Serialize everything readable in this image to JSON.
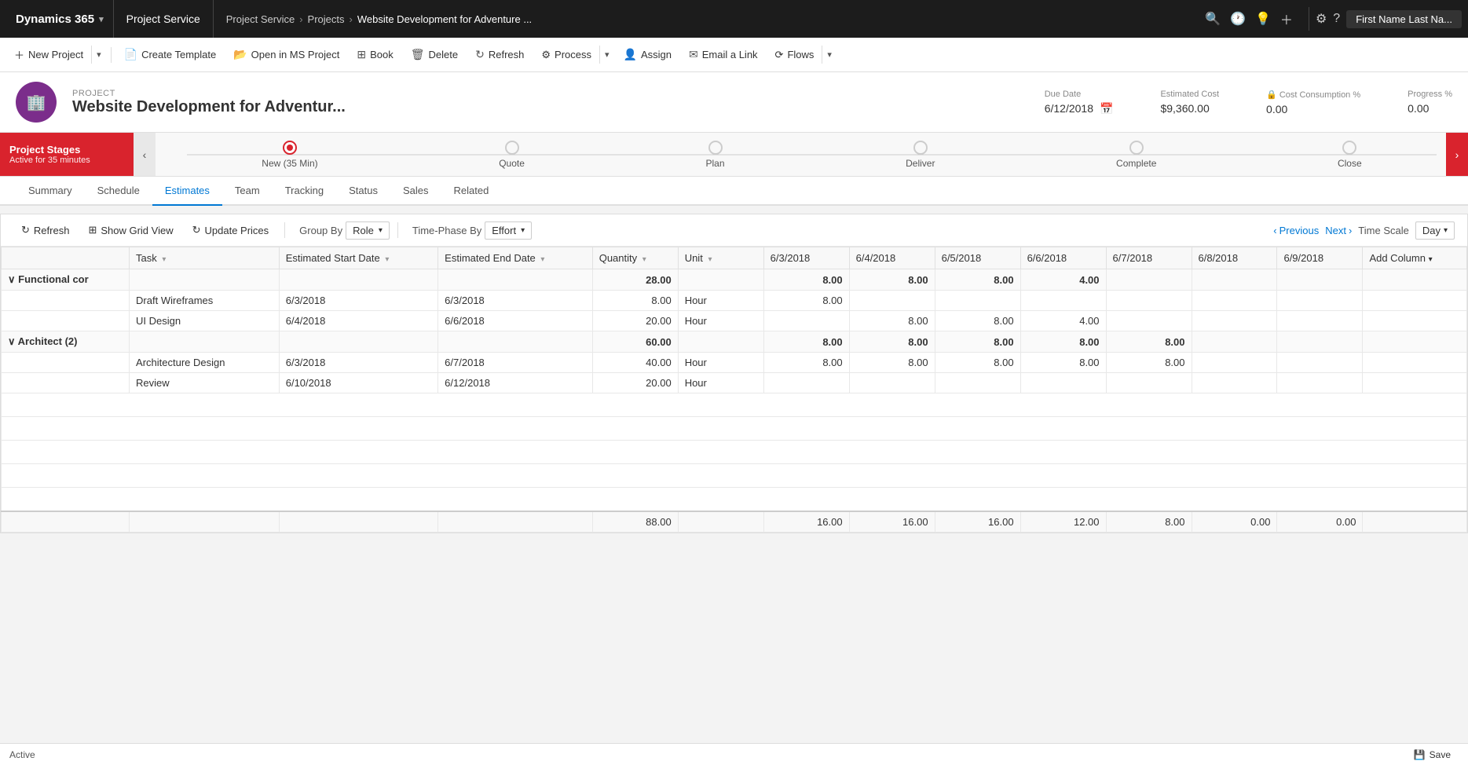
{
  "topNav": {
    "brand": "Dynamics 365",
    "brandChevron": "▾",
    "module": "Project Service",
    "breadcrumbs": [
      "Project Service",
      "Projects",
      "Website Development for Adventure ..."
    ],
    "breadcrumbSep": "›",
    "icons": [
      "🔍",
      "🕐",
      "💡",
      "＋"
    ],
    "settings": "⚙",
    "help": "?",
    "user": "First Name Last Na..."
  },
  "commandBar": {
    "buttons": [
      {
        "id": "new-project",
        "label": "New Project",
        "icon": "＋",
        "hasSplit": true
      },
      {
        "id": "create-template",
        "label": "Create Template",
        "icon": "📄",
        "hasSplit": false
      },
      {
        "id": "open-ms-project",
        "label": "Open in MS Project",
        "icon": "📂",
        "hasSplit": false
      },
      {
        "id": "book",
        "label": "Book",
        "icon": "⊞",
        "hasSplit": false
      },
      {
        "id": "delete",
        "label": "Delete",
        "icon": "🗑",
        "hasSplit": false
      },
      {
        "id": "refresh",
        "label": "Refresh",
        "icon": "↻",
        "hasSplit": false
      },
      {
        "id": "process",
        "label": "Process",
        "icon": "⚙",
        "hasSplit": true
      },
      {
        "id": "assign",
        "label": "Assign",
        "icon": "👤",
        "hasSplit": false
      },
      {
        "id": "email-link",
        "label": "Email a Link",
        "icon": "✉",
        "hasSplit": false
      },
      {
        "id": "flows",
        "label": "Flows",
        "icon": "⟳",
        "hasSplit": true
      }
    ]
  },
  "project": {
    "label": "PROJECT",
    "name": "Website Development for Adventur...",
    "avatarIcon": "🏢",
    "dueDateLabel": "Due Date",
    "dueDate": "6/12/2018",
    "calendarIcon": "📅",
    "estimatedCostLabel": "Estimated Cost",
    "estimatedCost": "$9,360.00",
    "costConsumptionLabel": "Cost Consumption %",
    "costConsumptionLockIcon": "🔒",
    "costConsumption": "0.00",
    "progressLabel": "Progress %",
    "progress": "0.00"
  },
  "stages": {
    "labelTitle": "Project Stages",
    "labelSub": "Active for 35 minutes",
    "items": [
      {
        "id": "new",
        "label": "New (35 Min)",
        "active": true
      },
      {
        "id": "quote",
        "label": "Quote",
        "active": false
      },
      {
        "id": "plan",
        "label": "Plan",
        "active": false
      },
      {
        "id": "deliver",
        "label": "Deliver",
        "active": false
      },
      {
        "id": "complete",
        "label": "Complete",
        "active": false
      },
      {
        "id": "close",
        "label": "Close",
        "active": false
      }
    ]
  },
  "tabs": {
    "items": [
      {
        "id": "summary",
        "label": "Summary",
        "active": false
      },
      {
        "id": "schedule",
        "label": "Schedule",
        "active": false
      },
      {
        "id": "estimates",
        "label": "Estimates",
        "active": true
      },
      {
        "id": "team",
        "label": "Team",
        "active": false
      },
      {
        "id": "tracking",
        "label": "Tracking",
        "active": false
      },
      {
        "id": "status",
        "label": "Status",
        "active": false
      },
      {
        "id": "sales",
        "label": "Sales",
        "active": false
      },
      {
        "id": "related",
        "label": "Related",
        "active": false
      }
    ]
  },
  "estimatesToolbar": {
    "refreshLabel": "Refresh",
    "showGridLabel": "Show Grid View",
    "updatePricesLabel": "Update Prices",
    "groupByLabel": "Group By",
    "groupByValue": "Role",
    "timePhaseByLabel": "Time-Phase By",
    "timePhaseByValue": "Effort",
    "previousLabel": "Previous",
    "nextLabel": "Next",
    "timeScaleLabel": "Time Scale",
    "timeScaleValue": "Day"
  },
  "grid": {
    "columns": [
      {
        "id": "col-blank",
        "label": "",
        "sortable": false
      },
      {
        "id": "col-task",
        "label": "Task",
        "sortable": true
      },
      {
        "id": "col-start",
        "label": "Estimated Start Date",
        "sortable": true
      },
      {
        "id": "col-end",
        "label": "Estimated End Date",
        "sortable": true
      },
      {
        "id": "col-qty",
        "label": "Quantity",
        "sortable": true
      },
      {
        "id": "col-unit",
        "label": "Unit",
        "sortable": true
      },
      {
        "id": "col-6-3",
        "label": "6/3/2018",
        "sortable": false
      },
      {
        "id": "col-6-4",
        "label": "6/4/2018",
        "sortable": false
      },
      {
        "id": "col-6-5",
        "label": "6/5/2018",
        "sortable": false
      },
      {
        "id": "col-6-6",
        "label": "6/6/2018",
        "sortable": false
      },
      {
        "id": "col-6-7",
        "label": "6/7/2018",
        "sortable": false
      },
      {
        "id": "col-6-8",
        "label": "6/8/2018",
        "sortable": false
      },
      {
        "id": "col-6-9",
        "label": "6/9/2018",
        "sortable": false
      },
      {
        "id": "col-add",
        "label": "Add Column",
        "sortable": false,
        "isAdd": true
      }
    ],
    "groups": [
      {
        "id": "functional-con",
        "label": "Functional con",
        "qty": "28.00",
        "unit": "",
        "d63": "8.00",
        "d64": "8.00",
        "d65": "8.00",
        "d66": "4.00",
        "d67": "",
        "d68": "",
        "d69": "",
        "rows": [
          {
            "task": "Draft Wireframes",
            "start": "6/3/2018",
            "end": "6/3/2018",
            "qty": "8.00",
            "unit": "Hour",
            "d63": "8.00",
            "d64": "",
            "d65": "",
            "d66": "",
            "d67": "",
            "d68": "",
            "d69": ""
          },
          {
            "task": "UI Design",
            "start": "6/4/2018",
            "end": "6/6/2018",
            "qty": "20.00",
            "unit": "Hour",
            "d63": "",
            "d64": "8.00",
            "d65": "8.00",
            "d66": "4.00",
            "d67": "",
            "d68": "",
            "d69": ""
          }
        ]
      },
      {
        "id": "architect-2",
        "label": "Architect (2)",
        "qty": "60.00",
        "unit": "",
        "d63": "8.00",
        "d64": "8.00",
        "d65": "8.00",
        "d66": "8.00",
        "d67": "8.00",
        "d68": "",
        "d69": "",
        "rows": [
          {
            "task": "Architecture Design",
            "start": "6/3/2018",
            "end": "6/7/2018",
            "qty": "40.00",
            "unit": "Hour",
            "d63": "8.00",
            "d64": "8.00",
            "d65": "8.00",
            "d66": "8.00",
            "d67": "8.00",
            "d68": "",
            "d69": ""
          },
          {
            "task": "Review",
            "start": "6/10/2018",
            "end": "6/12/2018",
            "qty": "20.00",
            "unit": "Hour",
            "d63": "",
            "d64": "",
            "d65": "",
            "d66": "",
            "d67": "",
            "d68": "",
            "d69": ""
          }
        ]
      }
    ],
    "footer": {
      "qty": "88.00",
      "d63": "16.00",
      "d64": "16.00",
      "d65": "16.00",
      "d66": "12.00",
      "d67": "8.00",
      "d68": "0.00",
      "d69": "0.00"
    }
  },
  "statusBar": {
    "status": "Active",
    "saveLabel": "Save",
    "saveIcon": "💾"
  }
}
